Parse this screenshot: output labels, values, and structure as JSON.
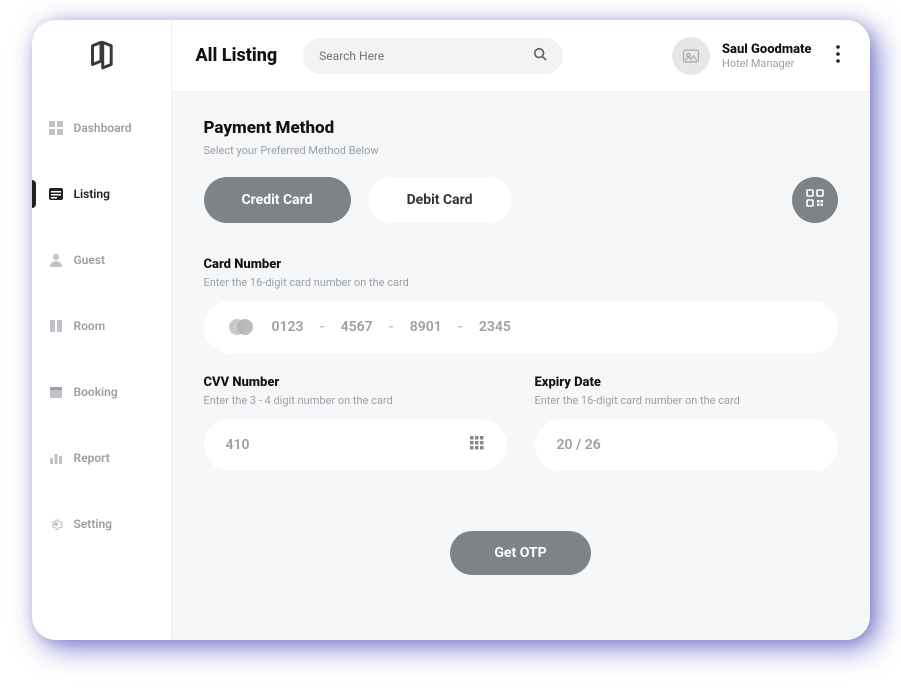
{
  "header": {
    "page_title": "All Listing",
    "search_placeholder": "Search Here",
    "user_name": "Saul Goodmate",
    "user_role": "Hotel Manager"
  },
  "sidebar": {
    "items": [
      {
        "label": "Dashboard"
      },
      {
        "label": "Listing"
      },
      {
        "label": "Guest"
      },
      {
        "label": "Room"
      },
      {
        "label": "Booking"
      },
      {
        "label": "Report"
      },
      {
        "label": "Setting"
      }
    ]
  },
  "payment": {
    "title": "Payment Method",
    "subtitle": "Select your Preferred Method Below",
    "methods": {
      "credit": "Credit Card",
      "debit": "Debit Card"
    },
    "card_number": {
      "label": "Card Number",
      "hint": "Enter the 16-digit card number on the card",
      "g1": "0123",
      "g2": "4567",
      "g3": "8901",
      "g4": "2345"
    },
    "cvv": {
      "label": "CVV Number",
      "hint": "Enter the 3 - 4 digit number on the card",
      "value": "410"
    },
    "expiry": {
      "label": "Expiry Date",
      "hint": "Enter the 16-digit card number on the card",
      "value": "20 / 26"
    },
    "otp_label": "Get OTP"
  }
}
